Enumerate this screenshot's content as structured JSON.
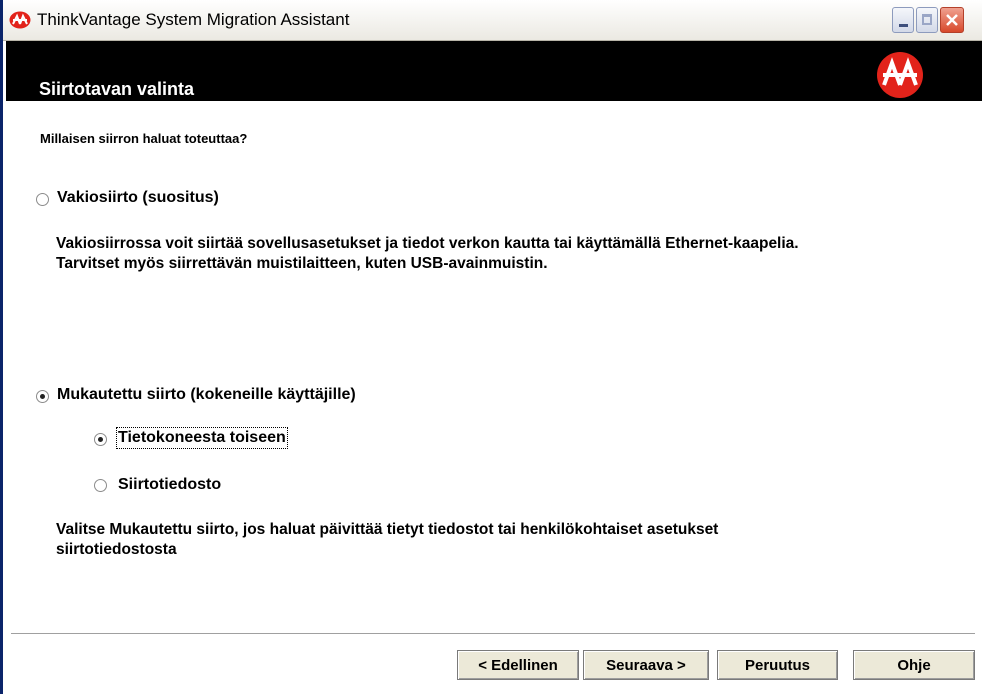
{
  "window": {
    "title": "ThinkVantage System Migration Assistant"
  },
  "banner": {
    "title": "Siirtotavan valinta"
  },
  "question": "Millaisen siirron haluat toteuttaa?",
  "options": {
    "standard": {
      "label": "Vakiosiirto (suositus)",
      "selected": false,
      "description_line1": "Vakiosiirrossa voit siirtää sovellusasetukset ja tiedot verkon kautta tai käyttämällä Ethernet-kaapelia.",
      "description_line2": "Tarvitset myös siirrettävän muistilaitteen, kuten USB-avainmuistin."
    },
    "custom": {
      "label": "Mukautettu siirto (kokeneille käyttäjille)",
      "selected": true,
      "sub_pc_to_pc": {
        "label": "Tietokoneesta toiseen",
        "selected": true
      },
      "sub_file": {
        "label": "Siirtotiedosto",
        "selected": false
      },
      "description_line1": "Valitse Mukautettu siirto, jos haluat päivittää tietyt tiedostot tai henkilökohtaiset asetukset",
      "description_line2": "siirtotiedostosta"
    }
  },
  "buttons": {
    "back": "< Edellinen",
    "next": "Seuraava >",
    "cancel": "Peruutus",
    "help": "Ohje"
  },
  "colors": {
    "banner_bg": "#000000",
    "logo_red": "#e2231a",
    "button_face": "#ece9d8"
  },
  "icons": {
    "app": "thinkvantage-logo-icon",
    "banner_logo": "thinkvantage-logo-icon",
    "minimize": "minimize-icon",
    "maximize": "maximize-icon",
    "close": "close-icon"
  }
}
